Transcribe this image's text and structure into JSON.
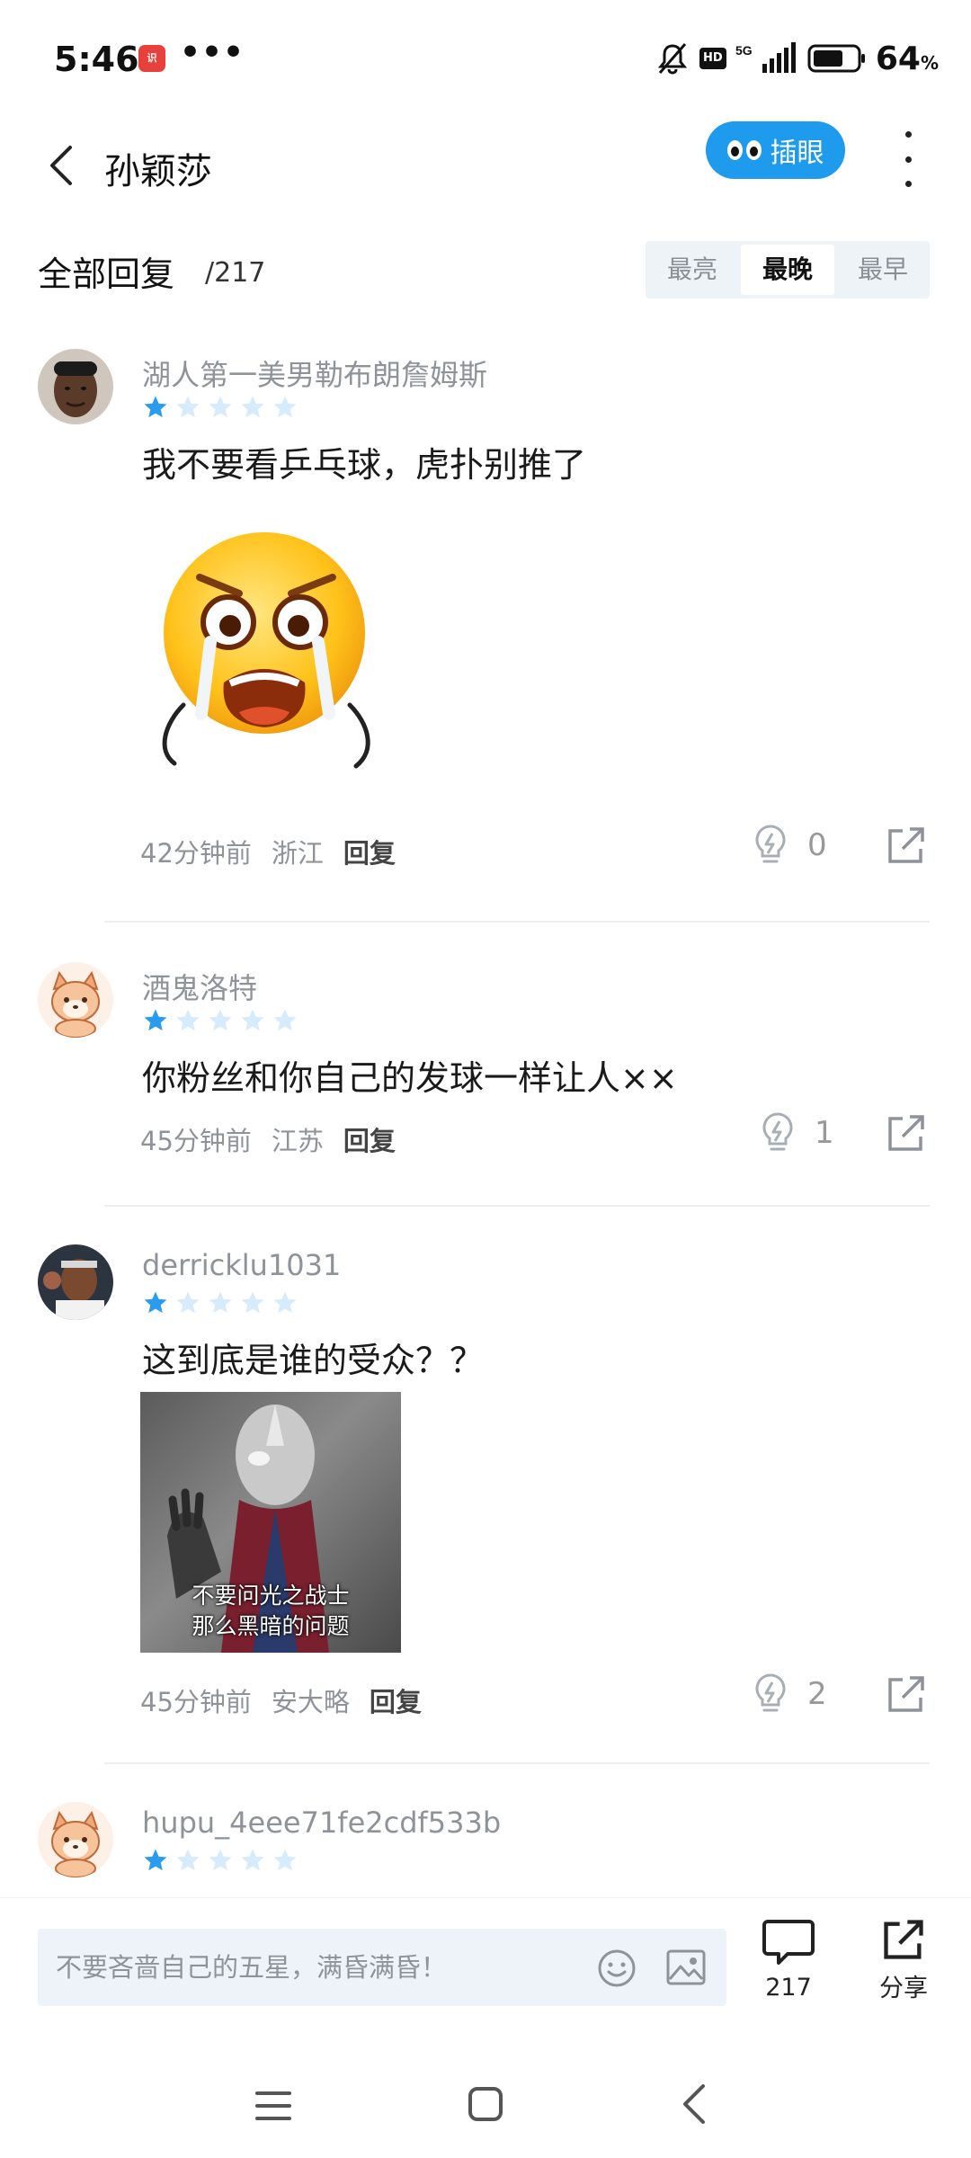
{
  "status_bar": {
    "time": "5:46",
    "app_badge": "识",
    "dots": "•••",
    "hd": "HD",
    "network": "5G",
    "battery": "64",
    "battery_unit": "%"
  },
  "header": {
    "title": "孙颖莎",
    "peek_label": "插眼"
  },
  "replies": {
    "title": "全部回复",
    "count": "/217",
    "sort_options": [
      "最亮",
      "最晚",
      "最早"
    ],
    "active_sort": "最晚"
  },
  "comments": [
    {
      "username": "湖人第一美男勒布朗詹姆斯",
      "rating": 1,
      "text": "我不要看乒乓球，虎扑别推了",
      "time": "42分钟前",
      "location": "浙江",
      "reply_label": "回复",
      "lights": "0"
    },
    {
      "username": "酒鬼洛特",
      "rating": 1,
      "text": "你粉丝和你自己的发球一样让人××",
      "time": "45分钟前",
      "location": "江苏",
      "reply_label": "回复",
      "lights": "1"
    },
    {
      "username": "derricklu1031",
      "rating": 1,
      "text": "这到底是谁的受众？？",
      "image_caption_line1": "不要问光之战士",
      "image_caption_line2": "那么黑暗的问题",
      "time": "45分钟前",
      "location": "安大略",
      "reply_label": "回复",
      "lights": "2"
    },
    {
      "username": "hupu_4eee71fe2cdf533b",
      "rating": 1
    }
  ],
  "input_bar": {
    "placeholder": "不要吝啬自己的五星，满昏满昏！",
    "replies_count": "217",
    "share_label": "分享"
  },
  "colors": {
    "accent": "#1e9bec",
    "star_filled": "#2a9cf0",
    "star_empty": "#d6ebfb",
    "muted_text": "#8e939a"
  }
}
